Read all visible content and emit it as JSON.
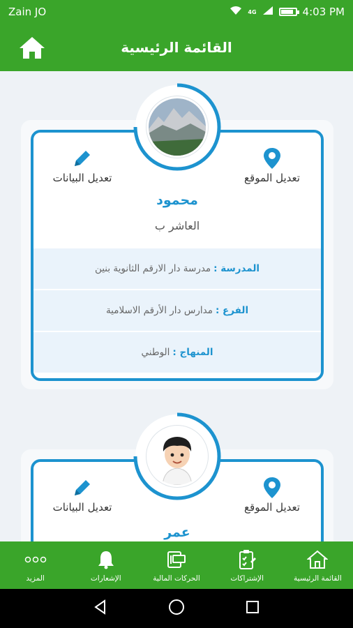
{
  "status_bar": {
    "carrier": "Zain JO",
    "network_badge": "4G",
    "time": "4:03 PM"
  },
  "app_bar": {
    "title": "القائمة الرئيسية",
    "icon": "home-icon"
  },
  "students": [
    {
      "name": "محمود",
      "grade": "العاشر ب",
      "edit_location_label": "تعديل الموقع",
      "edit_data_label": "تعديل البيانات",
      "info": [
        {
          "key": "المدرسة :",
          "value": "مدرسة دار الارقم الثانوية بنين"
        },
        {
          "key": "الفرع :",
          "value": "مدارس دار الأرقم الاسلامية"
        },
        {
          "key": "المنهاج :",
          "value": "الوطني"
        }
      ]
    },
    {
      "name": "عمر",
      "edit_location_label": "تعديل الموقع",
      "edit_data_label": "تعديل البيانات"
    }
  ],
  "bottom_nav": [
    {
      "label": "القائمة الرئيسية",
      "icon": "home-icon"
    },
    {
      "label": "الإشتراكات",
      "icon": "clipboard-icon"
    },
    {
      "label": "الحركات المالية",
      "icon": "cash-icon"
    },
    {
      "label": "الإشعارات",
      "icon": "bell-icon"
    },
    {
      "label": "المزيد",
      "icon": "more-icon"
    }
  ],
  "colors": {
    "primary_green": "#3aa52a",
    "accent_blue": "#1d93cf"
  }
}
